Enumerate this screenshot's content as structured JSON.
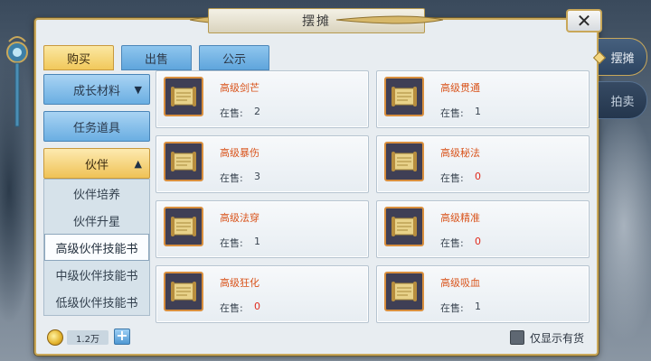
{
  "window": {
    "title": "摆摊",
    "close_label": "✕"
  },
  "top_tabs": [
    {
      "label": "购买",
      "active": true
    },
    {
      "label": "出售",
      "active": false
    },
    {
      "label": "公示",
      "active": false
    }
  ],
  "side_tabs": [
    {
      "label": "摆摊",
      "active": true
    },
    {
      "label": "拍卖",
      "active": false
    }
  ],
  "categories": {
    "growth": {
      "label": "成长材料",
      "arrow": "▼"
    },
    "quest": {
      "label": "任务道具"
    },
    "partner": {
      "label": "伙伴",
      "arrow": "▲"
    },
    "sub": [
      {
        "label": "伙伴培养"
      },
      {
        "label": "伙伴升星"
      },
      {
        "label": "高级伙伴技能书",
        "selected": true
      },
      {
        "label": "中级伙伴技能书"
      },
      {
        "label": "低级伙伴技能书"
      }
    ]
  },
  "items": [
    {
      "name": "高级剑芒",
      "stock_label": "在售:",
      "stock": "2"
    },
    {
      "name": "高级贯通",
      "stock_label": "在售:",
      "stock": "1"
    },
    {
      "name": "高级暴伤",
      "stock_label": "在售:",
      "stock": "3"
    },
    {
      "name": "高级秘法",
      "stock_label": "在售:",
      "stock": "0"
    },
    {
      "name": "高级法穿",
      "stock_label": "在售:",
      "stock": "1"
    },
    {
      "name": "高级精准",
      "stock_label": "在售:",
      "stock": "0"
    },
    {
      "name": "高级狂化",
      "stock_label": "在售:",
      "stock": "0"
    },
    {
      "name": "高级吸血",
      "stock_label": "在售:",
      "stock": "1"
    }
  ],
  "bottom": {
    "currency_amount": "1.2万",
    "plus_label": "+",
    "in_stock_only_label": "仅显示有货",
    "in_stock_only_checked": false
  },
  "colors": {
    "item_name": "#d9541c",
    "zero_stock": "#e02c1e",
    "gold_frame": "#c9a85a",
    "tab_blue": "#5fa5dc",
    "tab_gold": "#f1c85b"
  }
}
